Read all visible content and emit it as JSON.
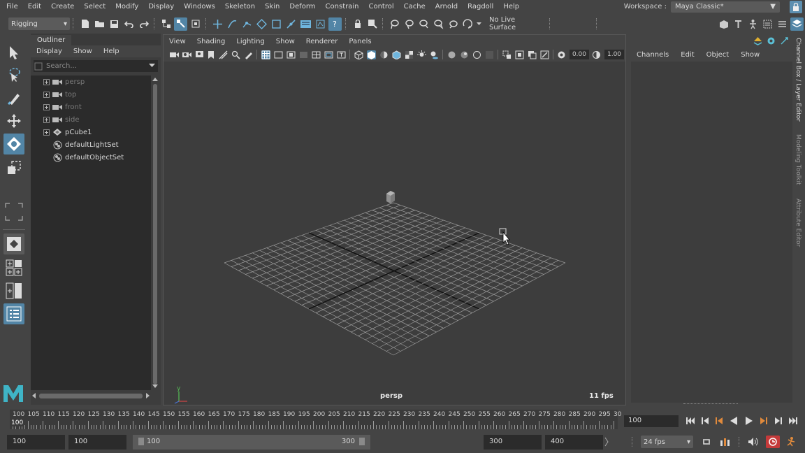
{
  "menubar": {
    "items": [
      "File",
      "Edit",
      "Create",
      "Select",
      "Modify",
      "Display",
      "Windows",
      "Skeleton",
      "Skin",
      "Deform",
      "Constrain",
      "Control",
      "Cache",
      "Arnold",
      "Ragdoll",
      "Help"
    ]
  },
  "workspace": {
    "label": "Workspace :",
    "value": "Maya Classic*"
  },
  "statusline": {
    "menuset": "Rigging",
    "live_surface": "No Live Surface"
  },
  "outliner": {
    "tab": "Outliner",
    "menus": [
      "Display",
      "Show",
      "Help"
    ],
    "search_placeholder": "Search...",
    "items": [
      {
        "label": "persp",
        "type": "camera",
        "expandable": true,
        "dim": true
      },
      {
        "label": "top",
        "type": "camera",
        "expandable": true,
        "dim": true
      },
      {
        "label": "front",
        "type": "camera",
        "expandable": true,
        "dim": true
      },
      {
        "label": "side",
        "type": "camera",
        "expandable": true,
        "dim": true
      },
      {
        "label": "pCube1",
        "type": "mesh",
        "expandable": true,
        "dim": false
      },
      {
        "label": "defaultLightSet",
        "type": "set",
        "expandable": false,
        "dim": false
      },
      {
        "label": "defaultObjectSet",
        "type": "set",
        "expandable": false,
        "dim": false
      }
    ]
  },
  "viewport": {
    "menus": [
      "View",
      "Shading",
      "Lighting",
      "Show",
      "Renderer",
      "Panels"
    ],
    "exposure": "0.00",
    "gamma": "1.00",
    "camera": "persp",
    "fps": "11 fps",
    "axis_y": "y"
  },
  "channelbox": {
    "menus": [
      "Channels",
      "Edit",
      "Object",
      "Show"
    ],
    "side_tabs": [
      "Channel Box / Layer Editor",
      "Modeling Toolkit",
      "Attribute Editor"
    ]
  },
  "timeslider": {
    "labels": [
      "100",
      "105",
      "110",
      "115",
      "120",
      "125",
      "130",
      "135",
      "140",
      "145",
      "150",
      "155",
      "160",
      "165",
      "170",
      "175",
      "180",
      "185",
      "190",
      "195",
      "200",
      "205",
      "210",
      "215",
      "220",
      "225",
      "230",
      "235",
      "240",
      "245",
      "250",
      "255",
      "260",
      "265",
      "270",
      "275",
      "280",
      "285",
      "290",
      "295",
      "30"
    ],
    "current_frame_marker": "100",
    "current_frame": "100"
  },
  "range": {
    "anim_start": "100",
    "playback_start": "100",
    "slider_start": "100",
    "slider_end": "300",
    "playback_end": "300",
    "anim_end": "400",
    "fps": "24 fps"
  },
  "colors": {
    "accent": "#5285a6",
    "panel": "#444444",
    "field": "#2b2b2b",
    "viewport_bg": "#3d3d3d"
  }
}
